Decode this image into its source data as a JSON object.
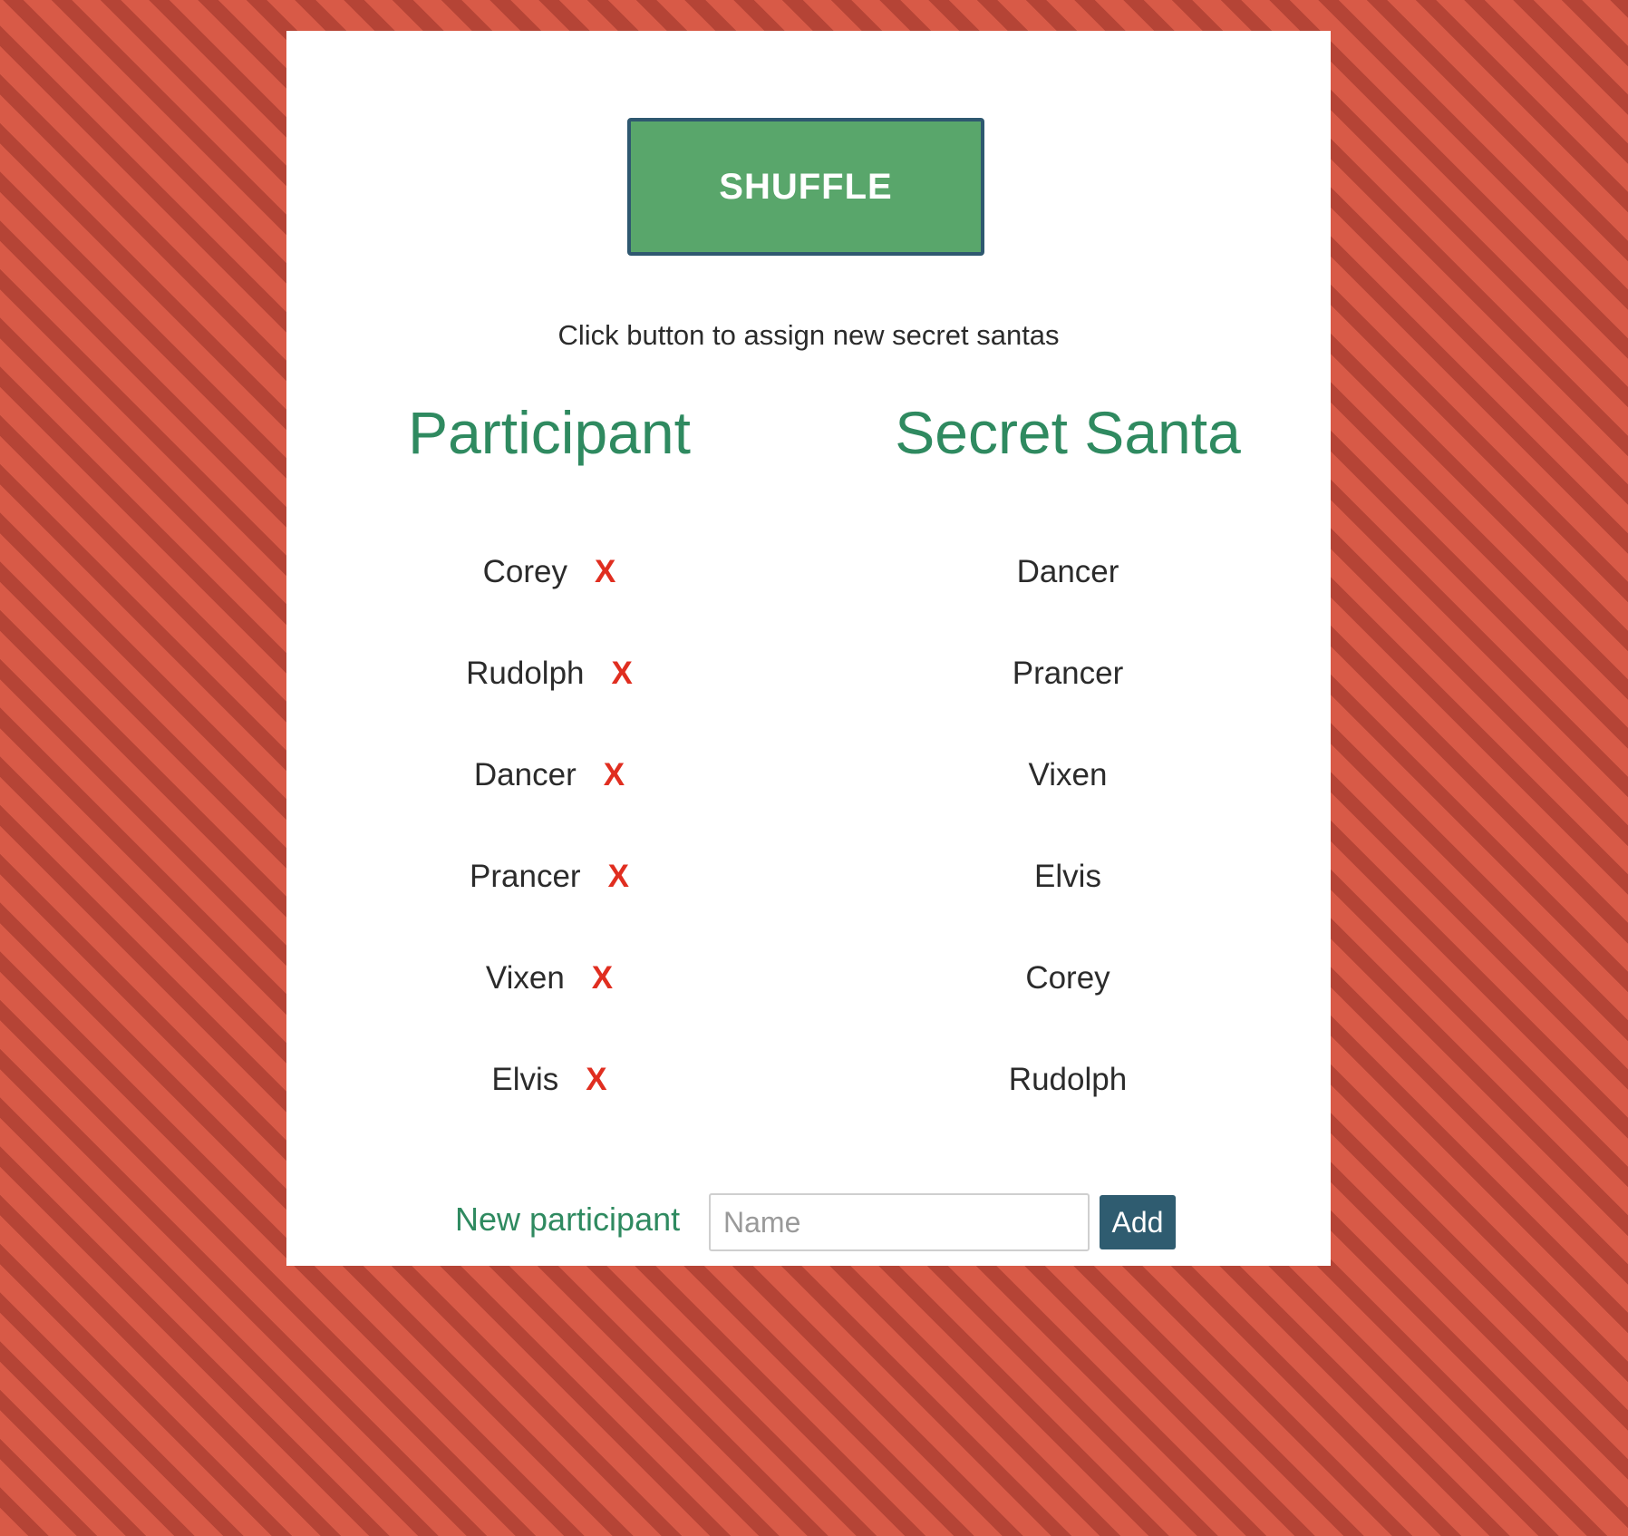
{
  "shuffle": {
    "label": "SHUFFLE"
  },
  "hint": "Click button to assign new secret santas",
  "columns": {
    "participant": "Participant",
    "santa": "Secret Santa"
  },
  "remove_label": "X",
  "participants": [
    "Corey",
    "Rudolph",
    "Dancer",
    "Prancer",
    "Vixen",
    "Elvis"
  ],
  "santas": [
    "Dancer",
    "Prancer",
    "Vixen",
    "Elvis",
    "Corey",
    "Rudolph"
  ],
  "new_participant": {
    "label": "New participant",
    "placeholder": "Name",
    "value": "",
    "add_label": "Add"
  },
  "colors": {
    "accent_green": "#2f8a60",
    "button_green": "#59a66b",
    "remove_red": "#e02e20",
    "dark_teal": "#2f5c70"
  }
}
